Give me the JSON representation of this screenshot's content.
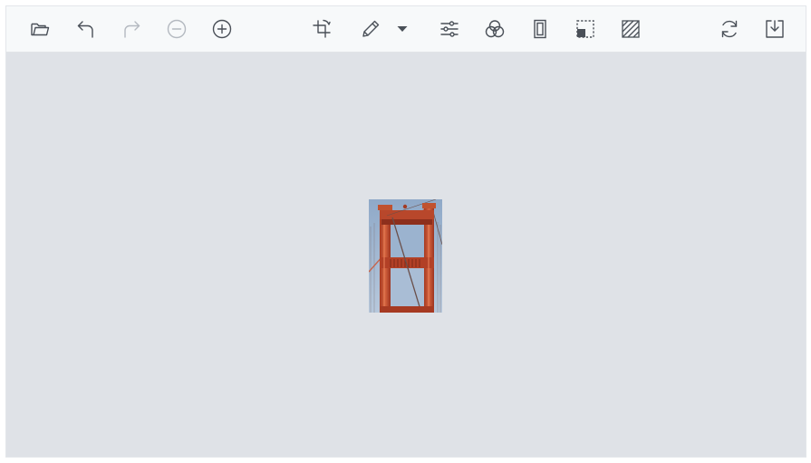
{
  "toolbar": {
    "left_icons": [
      "open-folder-icon",
      "undo-icon",
      "redo-icon",
      "zoom-out-icon",
      "zoom-in-icon"
    ],
    "center_icons": [
      "crop-transform-icon",
      "pencil-annotate-icon",
      "chevron-down-icon",
      "filter-sliders-icon",
      "color-filter-icon",
      "frame-icon",
      "resize-icon",
      "redact-icon"
    ],
    "right_icons": [
      "reset-icon",
      "save-download-icon"
    ],
    "redo_disabled": true,
    "zoom_out_disabled": true
  },
  "colors": {
    "toolbar_bg": "#f7f9fa",
    "canvas_bg": "#dfe2e7",
    "icon": "#4a5058",
    "icon_disabled": "#b4b9c0"
  },
  "canvas": {
    "image_subject": "bridge-tower-photo"
  }
}
